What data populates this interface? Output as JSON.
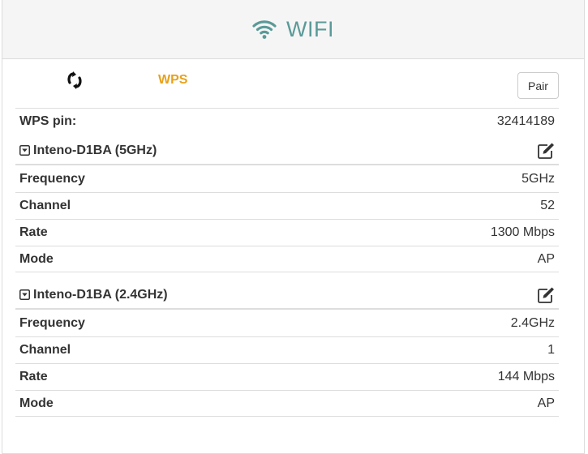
{
  "header": {
    "title": "WIFI",
    "icon": "wifi-icon",
    "title_color": "#5a9a98"
  },
  "wps": {
    "label": "WPS",
    "label_color": "#e8a11b",
    "toggle_icon": "refresh-toggle-icon",
    "pair_label": "Pair",
    "pin_label": "WPS pin:",
    "pin_value": "32414189"
  },
  "networks": [
    {
      "title": "Inteno-D1BA (5GHz)",
      "rows": [
        {
          "label": "Frequency",
          "value": "5GHz"
        },
        {
          "label": "Channel",
          "value": "52"
        },
        {
          "label": "Rate",
          "value": "1300 Mbps"
        },
        {
          "label": "Mode",
          "value": "AP"
        }
      ]
    },
    {
      "title": "Inteno-D1BA (2.4GHz)",
      "rows": [
        {
          "label": "Frequency",
          "value": "2.4GHz"
        },
        {
          "label": "Channel",
          "value": "1"
        },
        {
          "label": "Rate",
          "value": "144 Mbps"
        },
        {
          "label": "Mode",
          "value": "AP"
        }
      ]
    }
  ]
}
